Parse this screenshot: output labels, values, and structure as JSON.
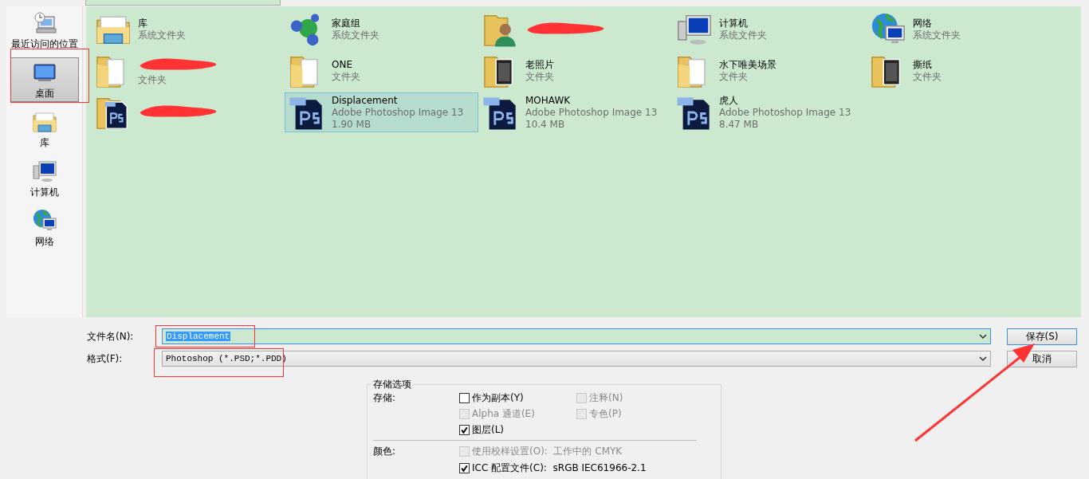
{
  "sidebar": {
    "items": [
      {
        "label": "最近访问的位置",
        "kind": "recent",
        "selected": false
      },
      {
        "label": "桌面",
        "kind": "desktop",
        "selected": true
      },
      {
        "label": "库",
        "kind": "library",
        "selected": false
      },
      {
        "label": "计算机",
        "kind": "computer",
        "selected": false
      },
      {
        "label": "网络",
        "kind": "network",
        "selected": false
      }
    ]
  },
  "files": [
    {
      "name": "库",
      "detail": "系统文件夹",
      "kind": "library",
      "selected": false,
      "redacted": false
    },
    {
      "name": "家庭组",
      "detail": "系统文件夹",
      "kind": "homegroup",
      "selected": false,
      "redacted": false
    },
    {
      "kind": "user",
      "selected": false,
      "redacted": true
    },
    {
      "name": "计算机",
      "detail": "系统文件夹",
      "kind": "computer",
      "selected": false,
      "redacted": false
    },
    {
      "name": "网络",
      "detail": "系统文件夹",
      "kind": "network",
      "selected": false,
      "redacted": false
    },
    {
      "detail": "文件夹",
      "kind": "folder",
      "selected": false,
      "redacted": true
    },
    {
      "name": "ONE",
      "detail": "文件夹",
      "kind": "folder",
      "selected": false,
      "redacted": false
    },
    {
      "name": "老照片",
      "detail": "文件夹",
      "kind": "photo-folder",
      "selected": false,
      "redacted": false
    },
    {
      "name": "水下唯美场景",
      "detail": "文件夹",
      "kind": "folder",
      "selected": false,
      "redacted": false
    },
    {
      "name": "撕纸",
      "detail": "文件夹",
      "kind": "photo-folder",
      "selected": false,
      "redacted": false
    },
    {
      "kind": "psd-folder",
      "selected": false,
      "redacted": true
    },
    {
      "name": "Displacement",
      "detail": "Adobe Photoshop Image 13",
      "size": "1.90 MB",
      "kind": "psd",
      "selected": true,
      "redacted": false
    },
    {
      "name": "MOHAWK",
      "detail": "Adobe Photoshop Image 13",
      "size": "10.4 MB",
      "kind": "psd",
      "selected": false,
      "redacted": false
    },
    {
      "name": "虎人",
      "detail": "Adobe Photoshop Image 13",
      "size": "8.47 MB",
      "kind": "psd",
      "selected": false,
      "redacted": false
    }
  ],
  "filename": {
    "label": "文件名(N):",
    "value": "Displacement"
  },
  "format": {
    "label": "格式(F):",
    "value": "Photoshop (*.PSD;*.PDD)"
  },
  "buttons": [
    {
      "label": "保存(S)",
      "kind": "default"
    },
    {
      "label": "取消",
      "kind": "normal"
    }
  ],
  "options": {
    "title": "存储选项",
    "groups": [
      {
        "label": "存储:",
        "kind": "grid",
        "checkboxes": [
          {
            "label": "作为副本(Y)",
            "checked": false,
            "disabled": false
          },
          {
            "label": "注释(N)",
            "checked": false,
            "disabled": true
          },
          {
            "label": "Alpha 通道(E)",
            "checked": false,
            "disabled": true
          },
          {
            "label": "专色(P)",
            "checked": false,
            "disabled": true
          },
          {
            "label": "图层(L)",
            "checked": true,
            "disabled": false
          }
        ]
      },
      {
        "label": "颜色:",
        "kind": "list",
        "checkboxes": [
          {
            "label": "使用校样设置(O):",
            "value": "工作中的 CMYK",
            "checked": false,
            "disabled": true
          },
          {
            "label": "ICC 配置文件(C):",
            "value": "sRGB IEC61966-2.1",
            "checked": true,
            "disabled": false
          }
        ]
      }
    ]
  }
}
